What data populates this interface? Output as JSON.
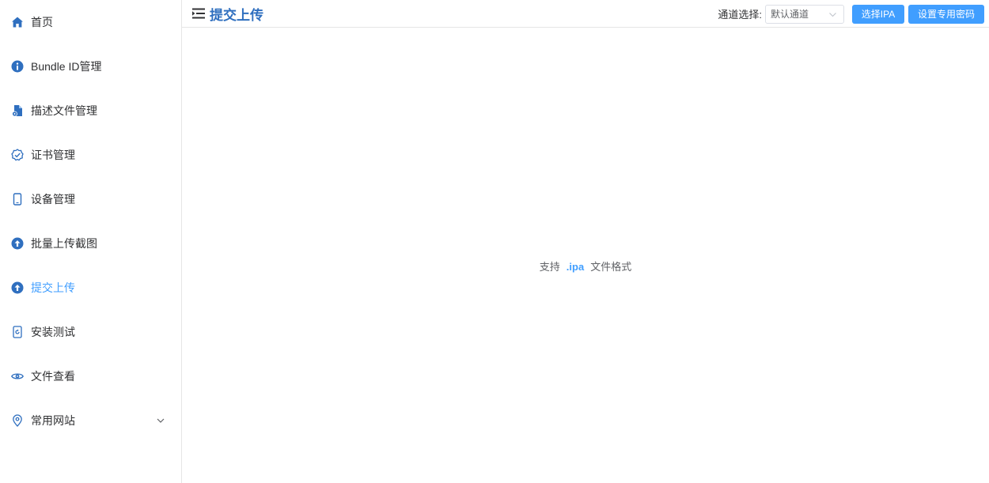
{
  "sidebar": {
    "items": [
      {
        "label": "首页",
        "icon": "home-icon"
      },
      {
        "label": "Bundle ID管理",
        "icon": "info-icon"
      },
      {
        "label": "描述文件管理",
        "icon": "document-gear-icon"
      },
      {
        "label": "证书管理",
        "icon": "badge-check-icon"
      },
      {
        "label": "设备管理",
        "icon": "phone-icon"
      },
      {
        "label": "批量上传截图",
        "icon": "upload-circle-icon"
      },
      {
        "label": "提交上传",
        "icon": "upload-circle-icon"
      },
      {
        "label": "安装测试",
        "icon": "install-icon"
      },
      {
        "label": "文件查看",
        "icon": "view-icon"
      },
      {
        "label": "常用网站",
        "icon": "location-icon"
      }
    ],
    "active_label": "提交上传"
  },
  "header": {
    "title": "提交上传",
    "channel_label": "通道选择:",
    "channel_value": "默认通道",
    "select_ipa_label": "选择IPA",
    "set_password_label": "设置专用密码"
  },
  "main": {
    "support_prefix": "支持",
    "support_ext": ".ipa",
    "support_suffix": "文件格式"
  },
  "colors": {
    "accent": "#409eff",
    "title": "#2f6fbf",
    "icon": "#2f6fbf",
    "border": "#e6e6e6"
  }
}
